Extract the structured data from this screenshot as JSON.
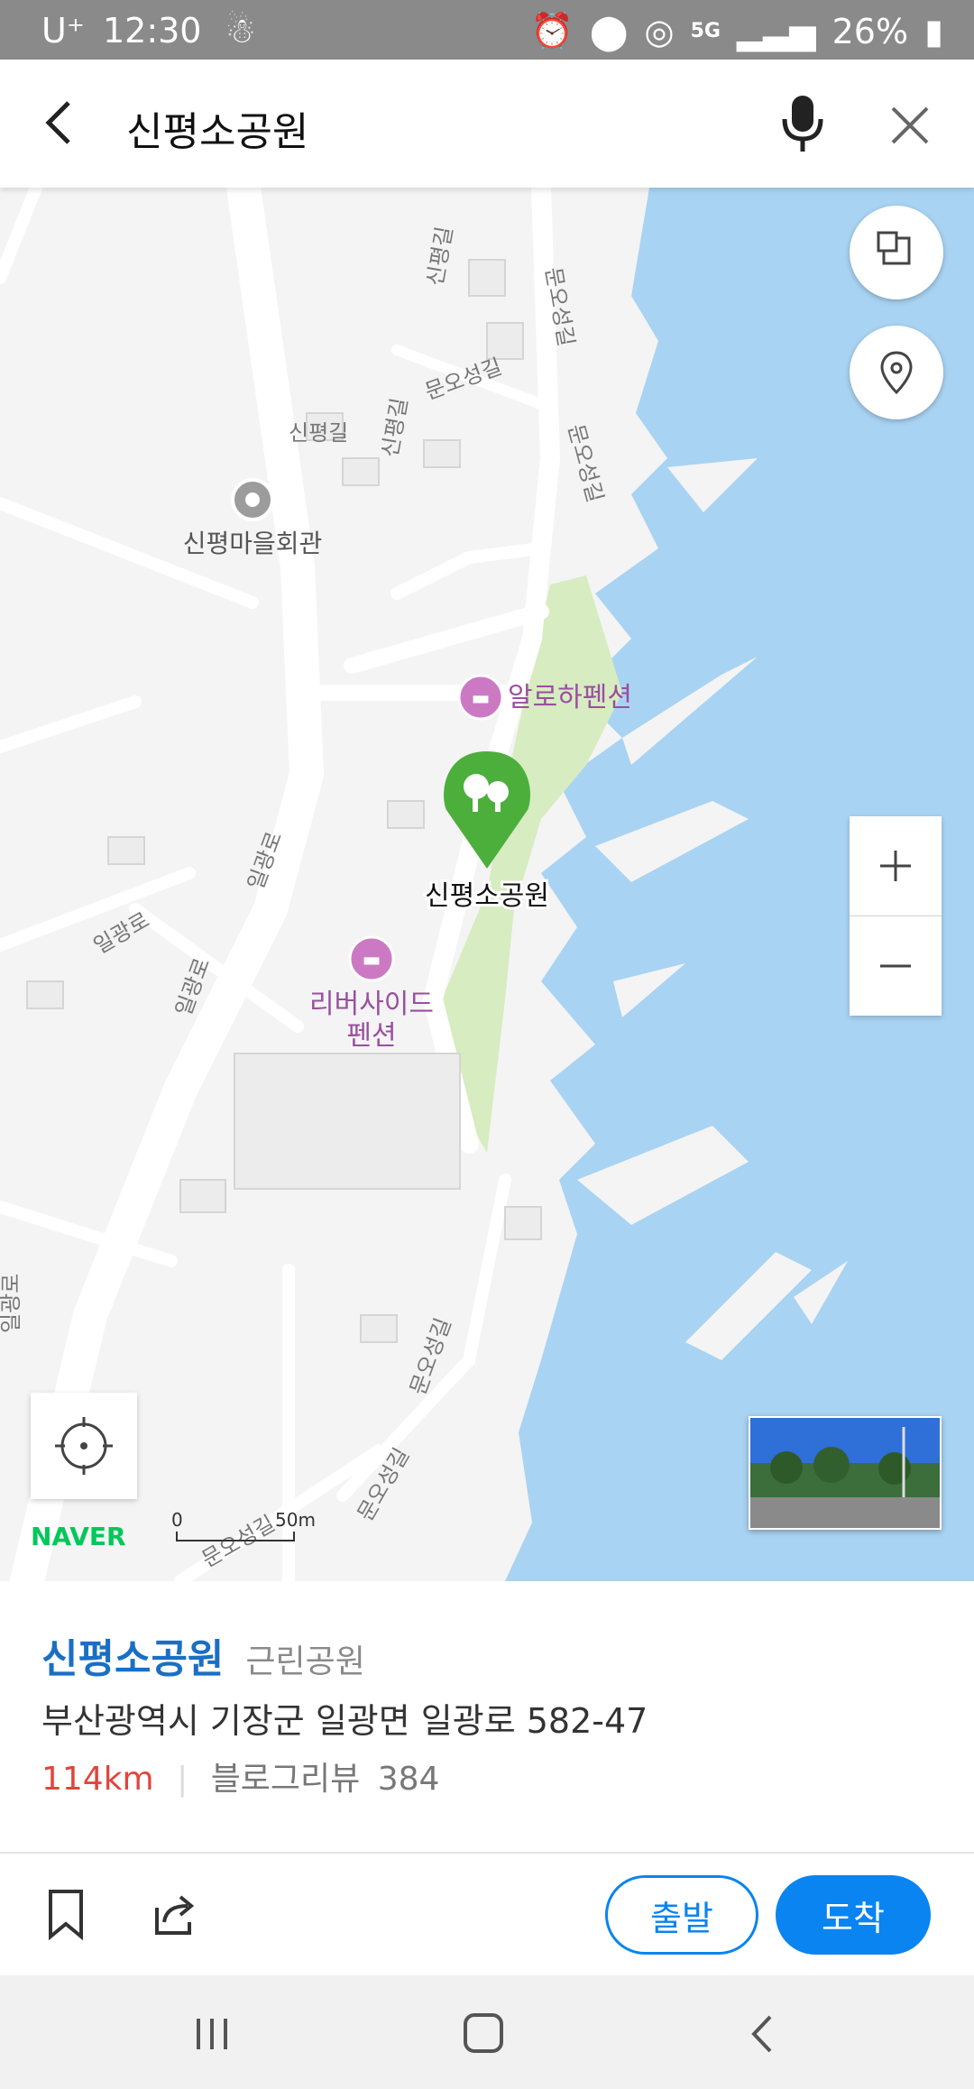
{
  "status_bar": {
    "carrier": "U⁺",
    "time": "12:30",
    "network": "5G",
    "battery": "26%"
  },
  "search": {
    "query": "신평소공원"
  },
  "map": {
    "road_labels": [
      "신평길",
      "문오성길",
      "신평길",
      "문오성길",
      "문오성길",
      "신평길",
      "일광로",
      "일광로",
      "일광로",
      "일광로",
      "문오성길",
      "문오성길",
      "문오성길"
    ],
    "poi_community_center": "신평마을회관",
    "poi_pension_aloha": "알로하펜션",
    "poi_pension_riverside_line1": "리버사이드",
    "poi_pension_riverside_line2": "펜션",
    "selected_place_label": "신평소공원",
    "logo": "NAVER",
    "scale_zero": "0",
    "scale_distance": "50m",
    "colors": {
      "sea": "#a9d3f2",
      "park": "#d7ecc1",
      "road": "#ffffff",
      "marker": "#4caf3c",
      "poi_pink": "#cc79c4",
      "logo_green": "#03c75a"
    }
  },
  "place": {
    "name": "신평소공원",
    "category": "근린공원",
    "address": "부산광역시 기장군 일광면 일광로 582-47",
    "distance": "114km",
    "review_label": "블로그리뷰",
    "review_count": "384"
  },
  "actions": {
    "depart_label": "출발",
    "arrive_label": "도착",
    "accent": "#0a84f0"
  },
  "icons": [
    "back-icon",
    "mic-icon",
    "close-icon",
    "layers-icon",
    "location-pin-icon",
    "plus-icon",
    "minus-icon",
    "crosshair-icon",
    "bookmark-icon",
    "share-icon",
    "recent-apps-icon",
    "home-icon",
    "nav-back-icon"
  ]
}
